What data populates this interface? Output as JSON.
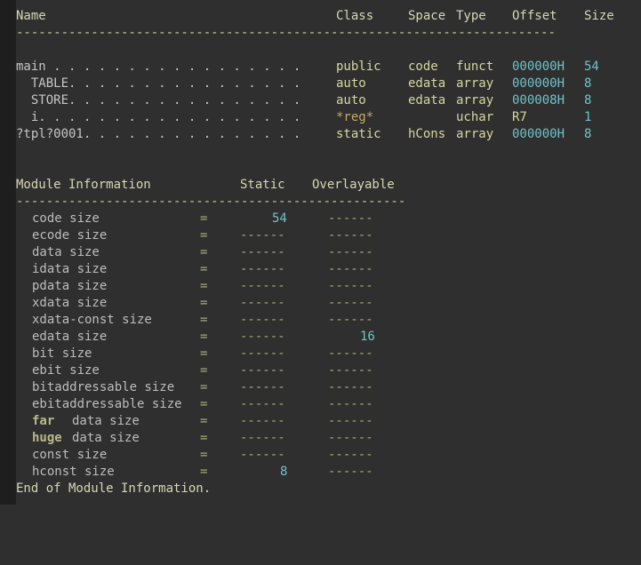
{
  "symbols": {
    "headers": {
      "name": "Name",
      "class": "Class",
      "space": "Space",
      "type": "Type",
      "offset": "Offset",
      "size": "Size"
    },
    "separator": "------------------------------------------------------------------------",
    "rows": [
      {
        "name": "main . . . . . . . . . . . . . . . . .",
        "class": "public",
        "space": "code",
        "type": "funct",
        "offset": "000000H",
        "size": "54"
      },
      {
        "name": "  TABLE. . . . . . . . . . . . . . . .",
        "class": "auto",
        "space": "edata",
        "type": "array",
        "offset": "000000H",
        "size": "8"
      },
      {
        "name": "  STORE. . . . . . . . . . . . . . . .",
        "class": "auto",
        "space": "edata",
        "type": "array",
        "offset": "000008H",
        "size": "8"
      },
      {
        "name": "  i. . . . . . . . . . . . . . . . . .",
        "class": "*reg*",
        "space": "",
        "type": "uchar",
        "offset": "R7",
        "size": "1"
      },
      {
        "name": "?tpl?0001. . . . . . . . . . . . . . .",
        "class": "static",
        "space": "hCons",
        "type": "array",
        "offset": "000000H",
        "size": "8"
      }
    ]
  },
  "module": {
    "headers": {
      "title": "Module Information",
      "static": "Static",
      "overlayable": "Overlayable"
    },
    "separator": "----------------------------------------------------",
    "rows": [
      {
        "label": "code size",
        "eq": "=",
        "static": "54",
        "overlay": "------"
      },
      {
        "label": "ecode size",
        "eq": "=",
        "static": "------",
        "overlay": "------"
      },
      {
        "label": "data size",
        "eq": "=",
        "static": "------",
        "overlay": "------"
      },
      {
        "label": "idata size",
        "eq": "=",
        "static": "------",
        "overlay": "------"
      },
      {
        "label": "pdata size",
        "eq": "=",
        "static": "------",
        "overlay": "------"
      },
      {
        "label": "xdata size",
        "eq": "=",
        "static": "------",
        "overlay": "------"
      },
      {
        "label": "xdata-const size",
        "eq": "=",
        "static": "------",
        "overlay": "------"
      },
      {
        "label": "edata size",
        "eq": "=",
        "static": "------",
        "overlay": "16"
      },
      {
        "label": "bit size",
        "eq": "=",
        "static": "------",
        "overlay": "------"
      },
      {
        "label": "ebit size",
        "eq": "=",
        "static": "------",
        "overlay": "------"
      },
      {
        "label": "bitaddressable size",
        "eq": "=",
        "static": "------",
        "overlay": "------"
      },
      {
        "label": "ebitaddressable size",
        "eq": "=",
        "static": "------",
        "overlay": "------"
      },
      {
        "label_kw": "far",
        "label": "data size",
        "eq": "=",
        "static": "------",
        "overlay": "------"
      },
      {
        "label_kw": "huge",
        "label": "data size",
        "eq": "=",
        "static": "------",
        "overlay": "------"
      },
      {
        "label": "const size",
        "eq": "=",
        "static": "------",
        "overlay": "------"
      },
      {
        "label": "hconst size",
        "eq": "=",
        "static": "8",
        "overlay": "------"
      }
    ],
    "footer": "End of Module Information."
  }
}
